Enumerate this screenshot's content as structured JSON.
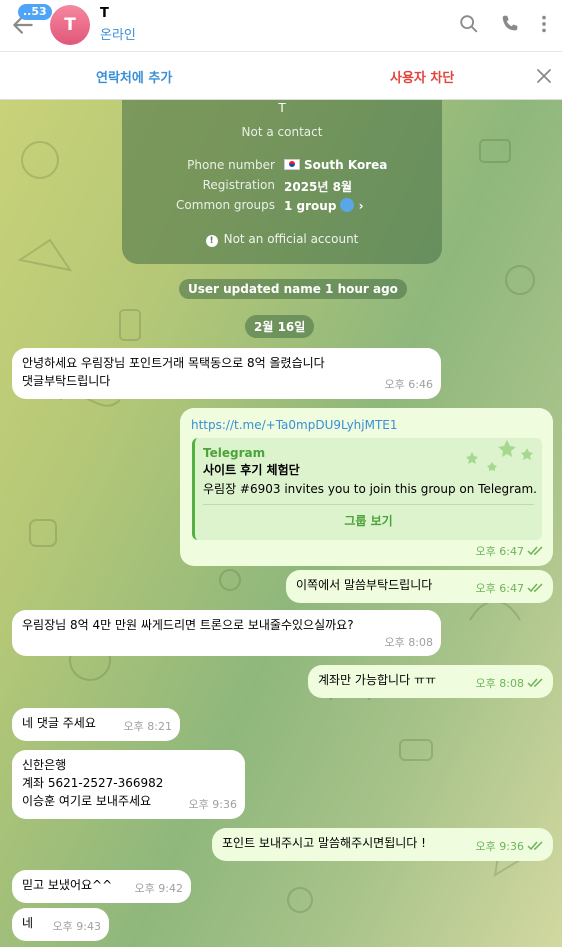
{
  "header": {
    "unread_count": "..53",
    "avatar_letter": "T",
    "name": "T",
    "status": "온라인"
  },
  "action_bar": {
    "add_contact": "연락처에 추가",
    "block_user": "사용자 차단"
  },
  "info_card": {
    "name": "T",
    "subtitle": "Not a contact",
    "phone_label": "Phone number",
    "phone_value": "South Korea",
    "registration_label": "Registration",
    "registration_value": "2025년 8월",
    "groups_label": "Common groups",
    "groups_value": "1 group",
    "official": "Not an official account"
  },
  "service": {
    "name_update": "User updated name 1 hour ago",
    "date": "2월 16일"
  },
  "messages": [
    {
      "dir": "in",
      "text": "안녕하세요 우림장님 포인트거래 목택동으로 8억 올렸습니다\n댓글부탁드립니다",
      "time": "오후 6:46"
    },
    {
      "dir": "out",
      "link": "https://t.me/+Ta0mpDU9LyhjMTE1",
      "preview_site": "Telegram",
      "preview_title": "사이트 후기 체험단",
      "preview_desc": "우림장 #6903 invites you to join this group on Telegram.",
      "preview_button": "그룹 보기",
      "time": "오후 6:47"
    },
    {
      "dir": "out",
      "text": "이쪽에서 말씀부탁드립니다",
      "time": "오후 6:47"
    },
    {
      "dir": "in",
      "text": "우림장님 8억 4만 만원 싸게드리면 트론으로 보내줄수있으실까요?",
      "time": "오후 8:08"
    },
    {
      "dir": "out",
      "text": "계좌만 가능합니다 ㅠㅠ",
      "time": "오후 8:08"
    },
    {
      "dir": "in",
      "text": "네 댓글 주세요",
      "time": "오후 8:21"
    },
    {
      "dir": "in",
      "text": "신한은행\n계좌 5621-2527-366982\n이승훈 여기로 보내주세요",
      "time": "오후 9:36"
    },
    {
      "dir": "out",
      "text": "포인트 보내주시고 말씀해주시면됩니다 !",
      "time": "오후 9:36"
    },
    {
      "dir": "in",
      "text": "믿고 보냈어요^^",
      "time": "오후 9:42"
    },
    {
      "dir": "in",
      "text": "네",
      "time": "오후 9:43"
    }
  ],
  "icons": {
    "back": "arrow-left-icon",
    "search": "search-icon",
    "call": "phone-icon",
    "menu": "more-vertical-icon",
    "close": "close-icon",
    "read": "double-check-icon"
  },
  "colors": {
    "accent": "#3a8fd6",
    "danger": "#e0443d",
    "outgoing_bubble": "#effdde",
    "incoming_bubble": "#ffffff",
    "time_outgoing": "#6eb35b"
  }
}
